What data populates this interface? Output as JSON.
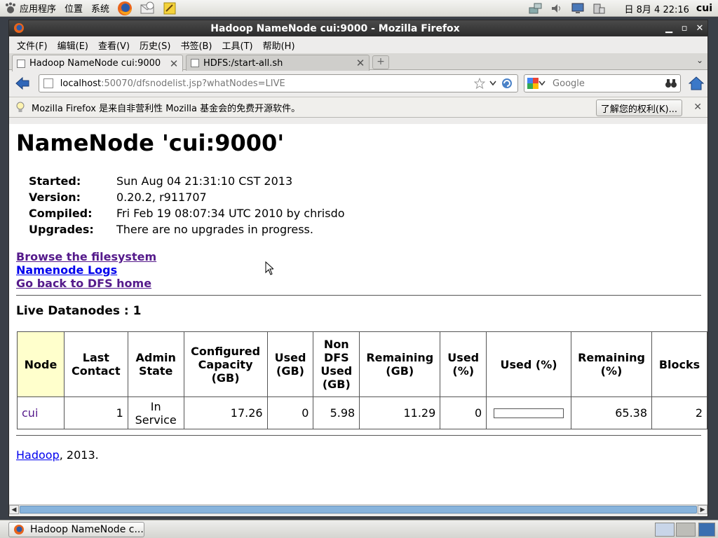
{
  "top_panel": {
    "menus": [
      "应用程序",
      "位置",
      "系统"
    ],
    "clock": "日 8月  4 22:16",
    "user": "cui"
  },
  "window": {
    "title": "Hadoop NameNode cui:9000 - Mozilla Firefox"
  },
  "menubar": {
    "items": [
      "文件(F)",
      "编辑(E)",
      "查看(V)",
      "历史(S)",
      "书签(B)",
      "工具(T)",
      "帮助(H)"
    ]
  },
  "tabs": [
    {
      "label": "Hadoop NameNode cui:9000",
      "active": true
    },
    {
      "label": "HDFS:/start-all.sh",
      "active": false
    }
  ],
  "navbar": {
    "url_host": "localhost",
    "url_rest": ":50070/dfsnodelist.jsp?whatNodes=LIVE",
    "search_placeholder": "Google"
  },
  "notice": {
    "text": "Mozilla Firefox 是来自非营利性 Mozilla 基金会的免费开源软件。",
    "button": "了解您的权利(K)..."
  },
  "page": {
    "heading": "NameNode 'cui:9000'",
    "info": [
      {
        "key": "Started:",
        "value": "Sun Aug 04 21:31:10 CST 2013"
      },
      {
        "key": "Version:",
        "value": "0.20.2, r911707"
      },
      {
        "key": "Compiled:",
        "value": "Fri Feb 19 08:07:34 UTC 2010 by chrisdo"
      },
      {
        "key": "Upgrades:",
        "value": "There are no upgrades in progress."
      }
    ],
    "links": [
      "Browse the filesystem",
      "Namenode Logs",
      "Go back to DFS home"
    ],
    "live_title": "Live Datanodes : 1",
    "table": {
      "headers": [
        "Node",
        "Last Contact",
        "Admin State",
        "Configured Capacity (GB)",
        "Used (GB)",
        "Non DFS Used (GB)",
        "Remaining (GB)",
        "Used (%)",
        "Used (%)",
        "Remaining (%)",
        "Blocks"
      ],
      "row": {
        "node": "cui",
        "last_contact": "1",
        "admin_state": "In Service",
        "configured_capacity": "17.26",
        "used_gb": "0",
        "non_dfs_used": "5.98",
        "remaining_gb": "11.29",
        "used_pct": "0",
        "used_bar_fraction": 0,
        "remaining_pct": "65.38",
        "blocks": "2"
      }
    },
    "footer_link": "Hadoop",
    "footer_rest": ", 2013."
  },
  "taskbar": {
    "task_label": "Hadoop NameNode c..."
  },
  "colors": {
    "node_header_bg": "#ffffcc",
    "visited_link": "#551a8b",
    "unvisited_link": "#0000ee",
    "titlebar": "#2c2c2c"
  }
}
